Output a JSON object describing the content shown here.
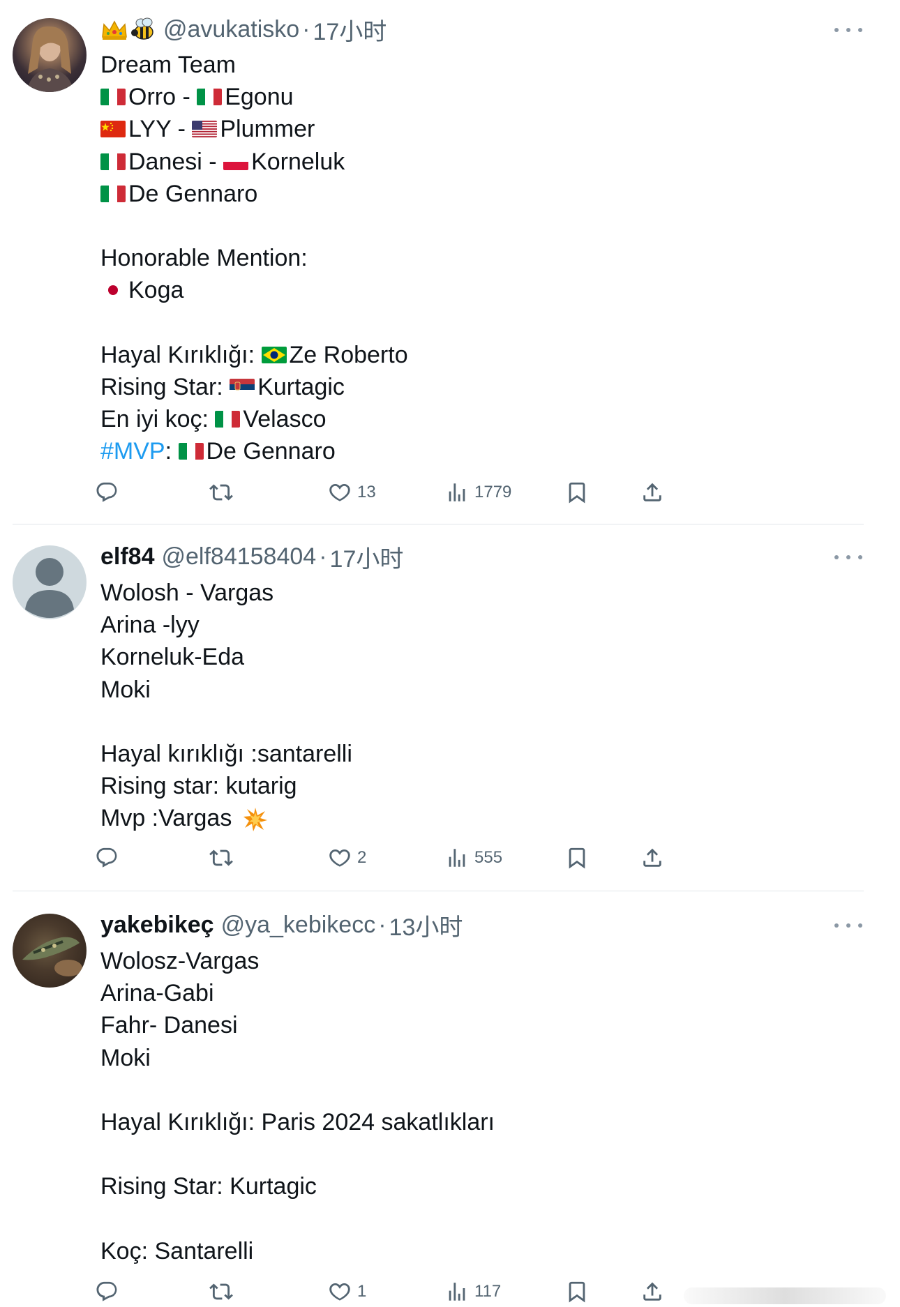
{
  "tweets": [
    {
      "name": "",
      "handle": "@avukatisko",
      "dot": "·",
      "time": "17小时",
      "lines": [
        {
          "text": "Dream Team"
        },
        {
          "parts": [
            {
              "flag": "it"
            },
            {
              "text": "Orro - "
            },
            {
              "flag": "it"
            },
            {
              "text": "Egonu"
            }
          ]
        },
        {
          "parts": [
            {
              "flag": "cn"
            },
            {
              "text": "LYY - "
            },
            {
              "flag": "us"
            },
            {
              "text": "Plummer"
            }
          ]
        },
        {
          "parts": [
            {
              "flag": "it"
            },
            {
              "text": "Danesi - "
            },
            {
              "flag": "pl"
            },
            {
              "text": "Korneluk"
            }
          ]
        },
        {
          "parts": [
            {
              "flag": "it"
            },
            {
              "text": "De Gennaro"
            }
          ]
        },
        {
          "text": ""
        },
        {
          "text": "Honorable Mention:"
        },
        {
          "parts": [
            {
              "flag": "jp"
            },
            {
              "text": "Koga"
            }
          ]
        },
        {
          "text": ""
        },
        {
          "parts": [
            {
              "text": "Hayal Kırıklığı: "
            },
            {
              "flag": "br"
            },
            {
              "text": "Ze Roberto"
            }
          ]
        },
        {
          "parts": [
            {
              "text": "Rising Star: "
            },
            {
              "flag": "rs"
            },
            {
              "text": "Kurtagic"
            }
          ]
        },
        {
          "parts": [
            {
              "text": "En iyi koç: "
            },
            {
              "flag": "it"
            },
            {
              "text": "Velasco"
            }
          ]
        },
        {
          "parts": [
            {
              "hashtag": "#MVP"
            },
            {
              "text": ": "
            },
            {
              "flag": "it"
            },
            {
              "text": "De Gennaro"
            }
          ]
        }
      ],
      "actions": {
        "replies": "",
        "retweets": "",
        "likes": "13",
        "views": "1779"
      }
    },
    {
      "name": "elf84",
      "handle": "@elf84158404",
      "dot": "·",
      "time": "17小时",
      "lines": [
        {
          "text": "Wolosh - Vargas"
        },
        {
          "text": "Arina -lyy"
        },
        {
          "text": "Korneluk-Eda"
        },
        {
          "text": "Moki"
        },
        {
          "text": ""
        },
        {
          "text": "Hayal kırıklığı :santarelli"
        },
        {
          "text": "Rising star: kutarig"
        },
        {
          "parts": [
            {
              "text": "Mvp :Vargas "
            },
            {
              "emoji": "💥"
            }
          ]
        }
      ],
      "actions": {
        "replies": "",
        "retweets": "",
        "likes": "2",
        "views": "555"
      }
    },
    {
      "name": "yakebikeç",
      "handle": "@ya_kebikecc",
      "dot": "·",
      "time": "13小时",
      "lines": [
        {
          "text": "Wolosz-Vargas"
        },
        {
          "text": "Arina-Gabi"
        },
        {
          "text": "Fahr- Danesi"
        },
        {
          "text": "Moki"
        },
        {
          "text": ""
        },
        {
          "text": "Hayal Kırıklığı: Paris 2024 sakatlıkları"
        },
        {
          "text": ""
        },
        {
          "text": "Rising Star: Kurtagic"
        },
        {
          "text": ""
        },
        {
          "text": "Koç: Santarelli"
        }
      ],
      "actions": {
        "replies": "",
        "retweets": "",
        "likes": "1",
        "views": "117"
      }
    }
  ],
  "icons": {
    "reply": "reply-icon",
    "retweet": "retweet-icon",
    "like": "heart-icon",
    "views": "views-icon",
    "bookmark": "bookmark-icon",
    "share": "share-icon",
    "more": "more-icon"
  },
  "colors": {
    "text": "#0f1419",
    "secondary": "#536471",
    "link": "#1d9bf0",
    "divider": "#e1e6ea"
  }
}
